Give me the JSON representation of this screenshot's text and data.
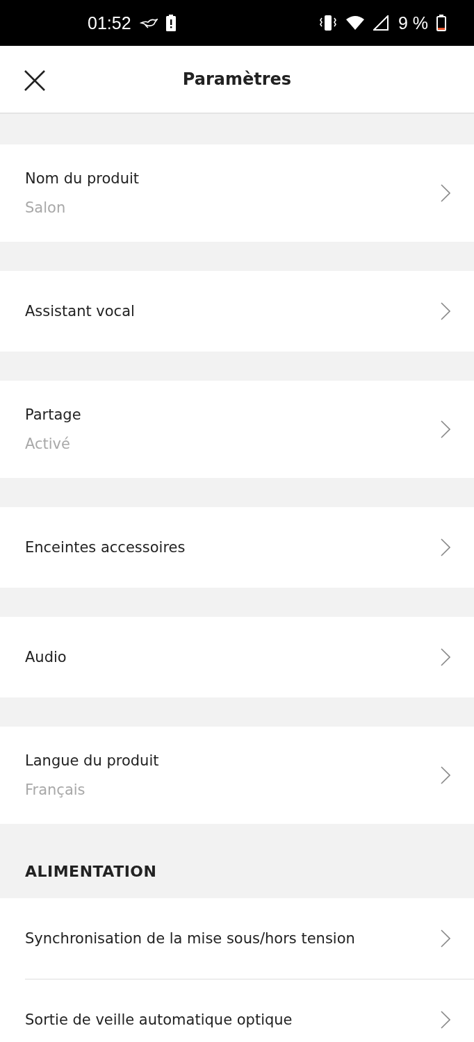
{
  "status_bar": {
    "time": "01:52",
    "battery_percent": "9 %"
  },
  "header": {
    "title": "Paramètres"
  },
  "groups": [
    {
      "items": [
        {
          "title": "Nom du produit",
          "subtitle": "Salon"
        }
      ]
    },
    {
      "items": [
        {
          "title": "Assistant vocal"
        }
      ]
    },
    {
      "items": [
        {
          "title": "Partage",
          "subtitle": "Activé"
        }
      ]
    },
    {
      "items": [
        {
          "title": "Enceintes accessoires"
        }
      ]
    },
    {
      "items": [
        {
          "title": "Audio"
        }
      ]
    },
    {
      "items": [
        {
          "title": "Langue du produit",
          "subtitle": "Français"
        }
      ]
    },
    {
      "header": "ALIMENTATION",
      "items": [
        {
          "title": "Synchronisation de la mise sous/hors tension"
        },
        {
          "title": "Sortie de veille automatique optique"
        }
      ]
    }
  ]
}
